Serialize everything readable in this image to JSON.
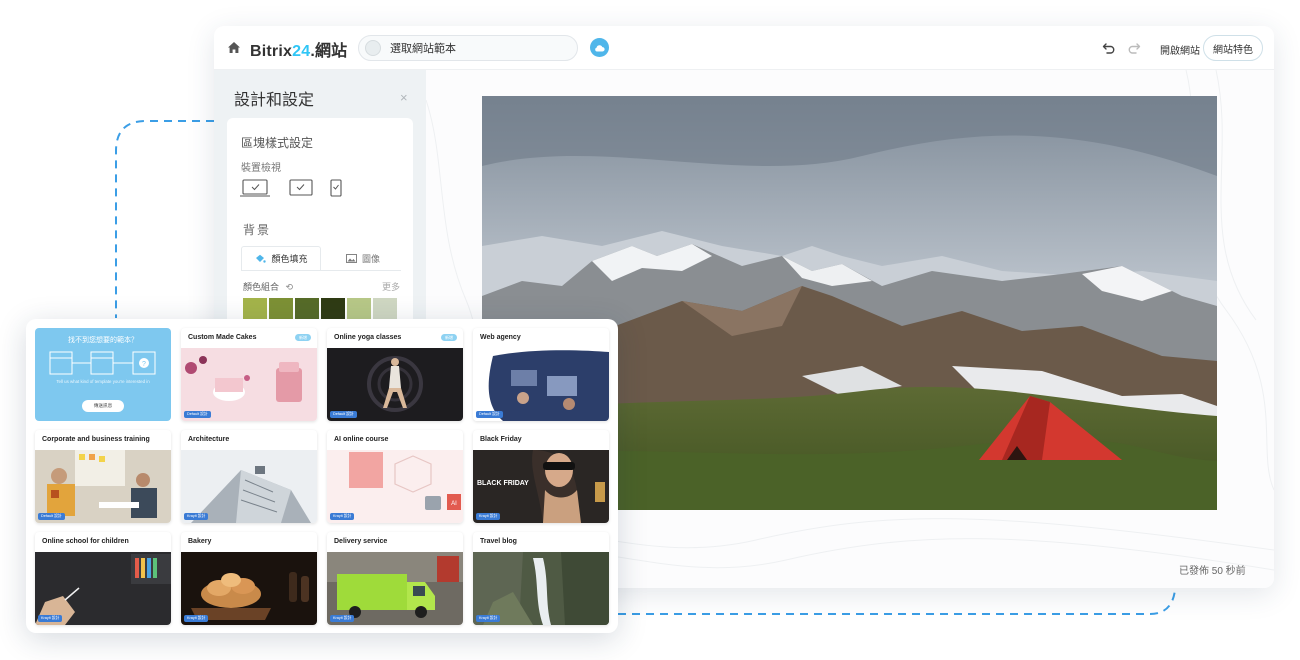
{
  "topbar": {
    "brand_main": "Bitrix",
    "brand_num": "24",
    "brand_suffix": ".網站",
    "template_select_label": "選取網站範本",
    "open_site_label": "開啟網站",
    "site_features_label": "網站特色"
  },
  "settings": {
    "title": "設計和設定",
    "close_icon": "×",
    "block_style_label": "區塊樣式設定",
    "device_view_label": "裝置檢視",
    "devices": [
      "desktop-icon",
      "tablet-icon",
      "mobile-icon"
    ],
    "background_label": "背景",
    "tabs": [
      {
        "label": "顏色填充",
        "icon": "paint-bucket-icon"
      },
      {
        "label": "圖像",
        "icon": "image-icon"
      }
    ],
    "palette_label": "顏色組合",
    "more_label": "更多",
    "swatches": [
      "#a4b44a",
      "#7d9135",
      "#566b28",
      "#2f3b14",
      "#b7c887",
      "#cfd7c2"
    ]
  },
  "canvas": {
    "published_text": "已發佈 50 秒前"
  },
  "chooser": {
    "request_card": {
      "title": "找不到您想要的範本？",
      "subtitle": "Tell us what kind of template you're interested in",
      "button_label": "傳送訊息"
    },
    "templates": [
      {
        "title": "Custom Made Cakes",
        "badge": "Default 設計",
        "new": true,
        "new_label": "新增"
      },
      {
        "title": "Online yoga classes",
        "badge": "Default 設計",
        "new": true,
        "new_label": "新增"
      },
      {
        "title": "Web agency",
        "badge": "Default 設計",
        "new": false
      },
      {
        "title": "Corporate and business training",
        "badge": "Default 設計",
        "new": false
      },
      {
        "title": "Architecture",
        "badge": "Kraylt 設計",
        "new": false
      },
      {
        "title": "AI online course",
        "badge": "Kraylt 設計",
        "new": false
      },
      {
        "title": "Black Friday",
        "badge": "Kraylt 設計",
        "new": false
      },
      {
        "title": "Online school for children",
        "badge": "Kraylt 設計",
        "new": false
      },
      {
        "title": "Bakery",
        "badge": "Kraylt 設計",
        "new": false
      },
      {
        "title": "Delivery service",
        "badge": "Kraylt 設計",
        "new": false
      },
      {
        "title": "Travel blog",
        "badge": "Kraylt 設計",
        "new": false
      }
    ],
    "black_friday_banner": "BLACK FRIDAY",
    "ai_tag": "AI"
  },
  "colors": {
    "accent_blue": "#2fc6f6",
    "request_card_bg": "#7ec8ef",
    "dashed_line": "#3b9ee6"
  }
}
